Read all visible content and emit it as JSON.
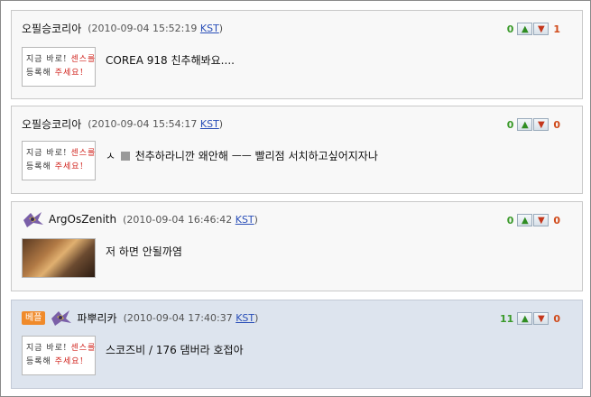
{
  "comments": [
    {
      "author": "오필승코리아",
      "date": "(2010-09-04 15:52:19",
      "tz": "KST",
      "close": ")",
      "text": "COREA 918 친추해봐요....",
      "up": "0",
      "down": "1",
      "avatar": "handwritten-note",
      "note_line1_a": "지금 바로! ",
      "note_line1_b": "센스를",
      "note_line2_a": "등록해 ",
      "note_line2_b": "주세요!"
    },
    {
      "author": "오필승코리아",
      "date": "(2010-09-04 15:54:17",
      "tz": "KST",
      "close": ")",
      "text_a": "ㅅ",
      "text_b": "천추하라니깐 왜안해 ㅡㅡ 빨리점 서치하고싶어지자나",
      "up": "0",
      "down": "0",
      "note_line1_a": "지금 바로! ",
      "note_line1_b": "센스를",
      "note_line2_a": "등록해 ",
      "note_line2_b": "주세요!"
    },
    {
      "author": "ArgOsZenith",
      "date": "(2010-09-04 16:46:42",
      "tz": "KST",
      "close": ")",
      "text": "저 하면 안될까염",
      "up": "0",
      "down": "0"
    },
    {
      "badge": "베플",
      "author": "파뿌리카",
      "date": "(2010-09-04 17:40:37",
      "tz": "KST",
      "close": ")",
      "text": "스코즈비 / 176 댐버라 호접아",
      "up": "11",
      "down": "0",
      "note_line1_a": "지금 바로! ",
      "note_line1_b": "센스를",
      "note_line2_a": "등록해 ",
      "note_line2_b": "주세요!"
    }
  ],
  "colors": {
    "up": "#3a9a2a",
    "down": "#d04a1a",
    "best_bg": "#dde4ee",
    "badge": "#f08a2a"
  },
  "icons": {
    "up_button": "thumbs-up-icon",
    "down_button": "thumbs-down-icon",
    "avatar": "race-icon"
  }
}
